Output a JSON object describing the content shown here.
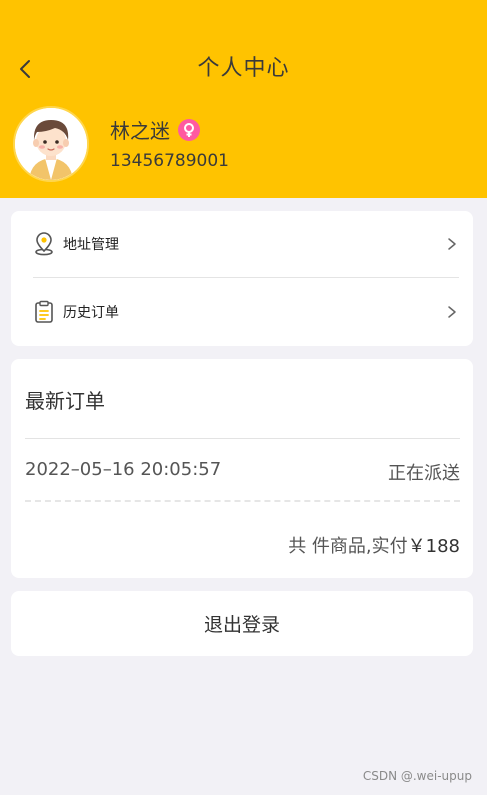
{
  "header": {
    "title": "个人中心",
    "back_icon": "chevron-left-icon",
    "background": "#ffc300"
  },
  "user": {
    "name": "林之迷",
    "gender_icon": "female-icon",
    "phone": "13456789001"
  },
  "menu": {
    "items": [
      {
        "label": "地址管理",
        "icon": "location-pin-icon"
      },
      {
        "label": "历史订单",
        "icon": "clipboard-icon"
      }
    ]
  },
  "latest_order": {
    "title": "最新订单",
    "time": "2022–05–16 20:05:57",
    "status": "正在派送",
    "summary_prefix": "共 件商品,实付",
    "price": "￥188"
  },
  "logout": {
    "label": "退出登录"
  },
  "watermark": "CSDN @.wei-upup"
}
